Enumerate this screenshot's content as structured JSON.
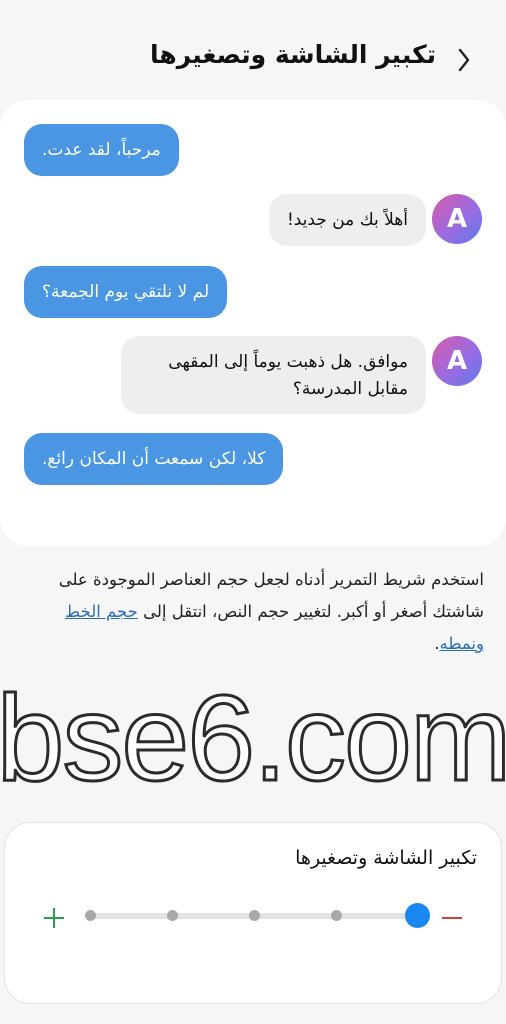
{
  "header": {
    "title": "تكبير الشاشة وتصغيرها"
  },
  "chat": {
    "messages": [
      {
        "text": "مرحباً، لقد عدت."
      },
      {
        "text": "أهلاً بك من جديد!"
      },
      {
        "text": "لم لا نلتقي يوم الجمعة؟"
      },
      {
        "text": "موافق. هل ذهبت يوماً إلى المقهى مقابل المدرسة؟"
      },
      {
        "text": "كلا، لكن سمعت أن المكان رائع."
      }
    ],
    "avatar_letter": "A"
  },
  "description": {
    "text": "استخدم شريط التمرير أدناه لجعل حجم العناصر الموجودة على شاشتك أصغر أو أكبر. لتغيير حجم النص، انتقل إلى ",
    "link": "حجم الخط ونمطه",
    "end": "."
  },
  "watermark": {
    "text": "bse6.com"
  },
  "slider": {
    "title": "تكبير الشاشة وتصغيرها",
    "steps": 5,
    "selected_step": 1,
    "colors": {
      "plus": "#2e9e4f",
      "minus": "#d63c3c",
      "thumb": "#1a86f0"
    }
  }
}
